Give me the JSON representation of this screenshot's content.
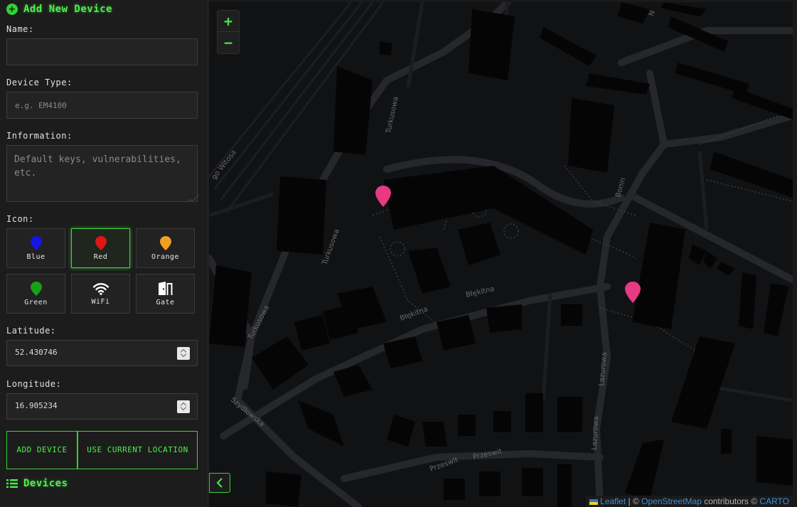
{
  "sidebar": {
    "add_title": "Add New Device",
    "name_label": "Name:",
    "name_value": "",
    "type_label": "Device Type:",
    "type_placeholder": "e.g. EM4100",
    "info_label": "Information:",
    "info_placeholder": "Default keys, vulnerabilities, etc.",
    "icon_label": "Icon:",
    "icons": [
      {
        "label": "Blue",
        "icon": "blue-pin-icon",
        "color": "#1515e0",
        "selected": false
      },
      {
        "label": "Red",
        "icon": "red-pin-icon",
        "color": "#e01515",
        "selected": true
      },
      {
        "label": "Orange",
        "icon": "orange-pin-icon",
        "color": "#f0a020",
        "selected": false
      },
      {
        "label": "Green",
        "icon": "green-pin-icon",
        "color": "#18a018",
        "selected": false
      },
      {
        "label": "WiFi",
        "icon": "wifi-icon",
        "color": "#ffffff",
        "selected": false
      },
      {
        "label": "Gate",
        "icon": "gate-icon",
        "color": "#ffffff",
        "selected": false
      }
    ],
    "lat_label": "Latitude:",
    "lat_value": "52.430746",
    "lon_label": "Longitude:",
    "lon_value": "16.905234",
    "add_button": "ADD DEVICE",
    "location_button": "USE CURRENT LOCATION",
    "devices_title": "Devices"
  },
  "map": {
    "zoom_in": "+",
    "zoom_out": "−",
    "streets": [
      "go Witosa",
      "Turkusowa",
      "Turkusowa",
      "Turkusowa",
      "Błękitna",
      "Błękitna",
      "Lazurowa",
      "Lazurowa",
      "Szydłowska",
      "Przeswit",
      "Przeswit",
      "Bonin",
      "N"
    ],
    "marker_color": "#ff3f8e",
    "attribution": {
      "leaflet": "Leaflet",
      "sep": " | © ",
      "osm": "OpenStreetMap",
      "mid": " contributors © ",
      "carto": "CARTO"
    }
  },
  "colors": {
    "accent": "#4cf04c",
    "map_bg": "#111214"
  }
}
